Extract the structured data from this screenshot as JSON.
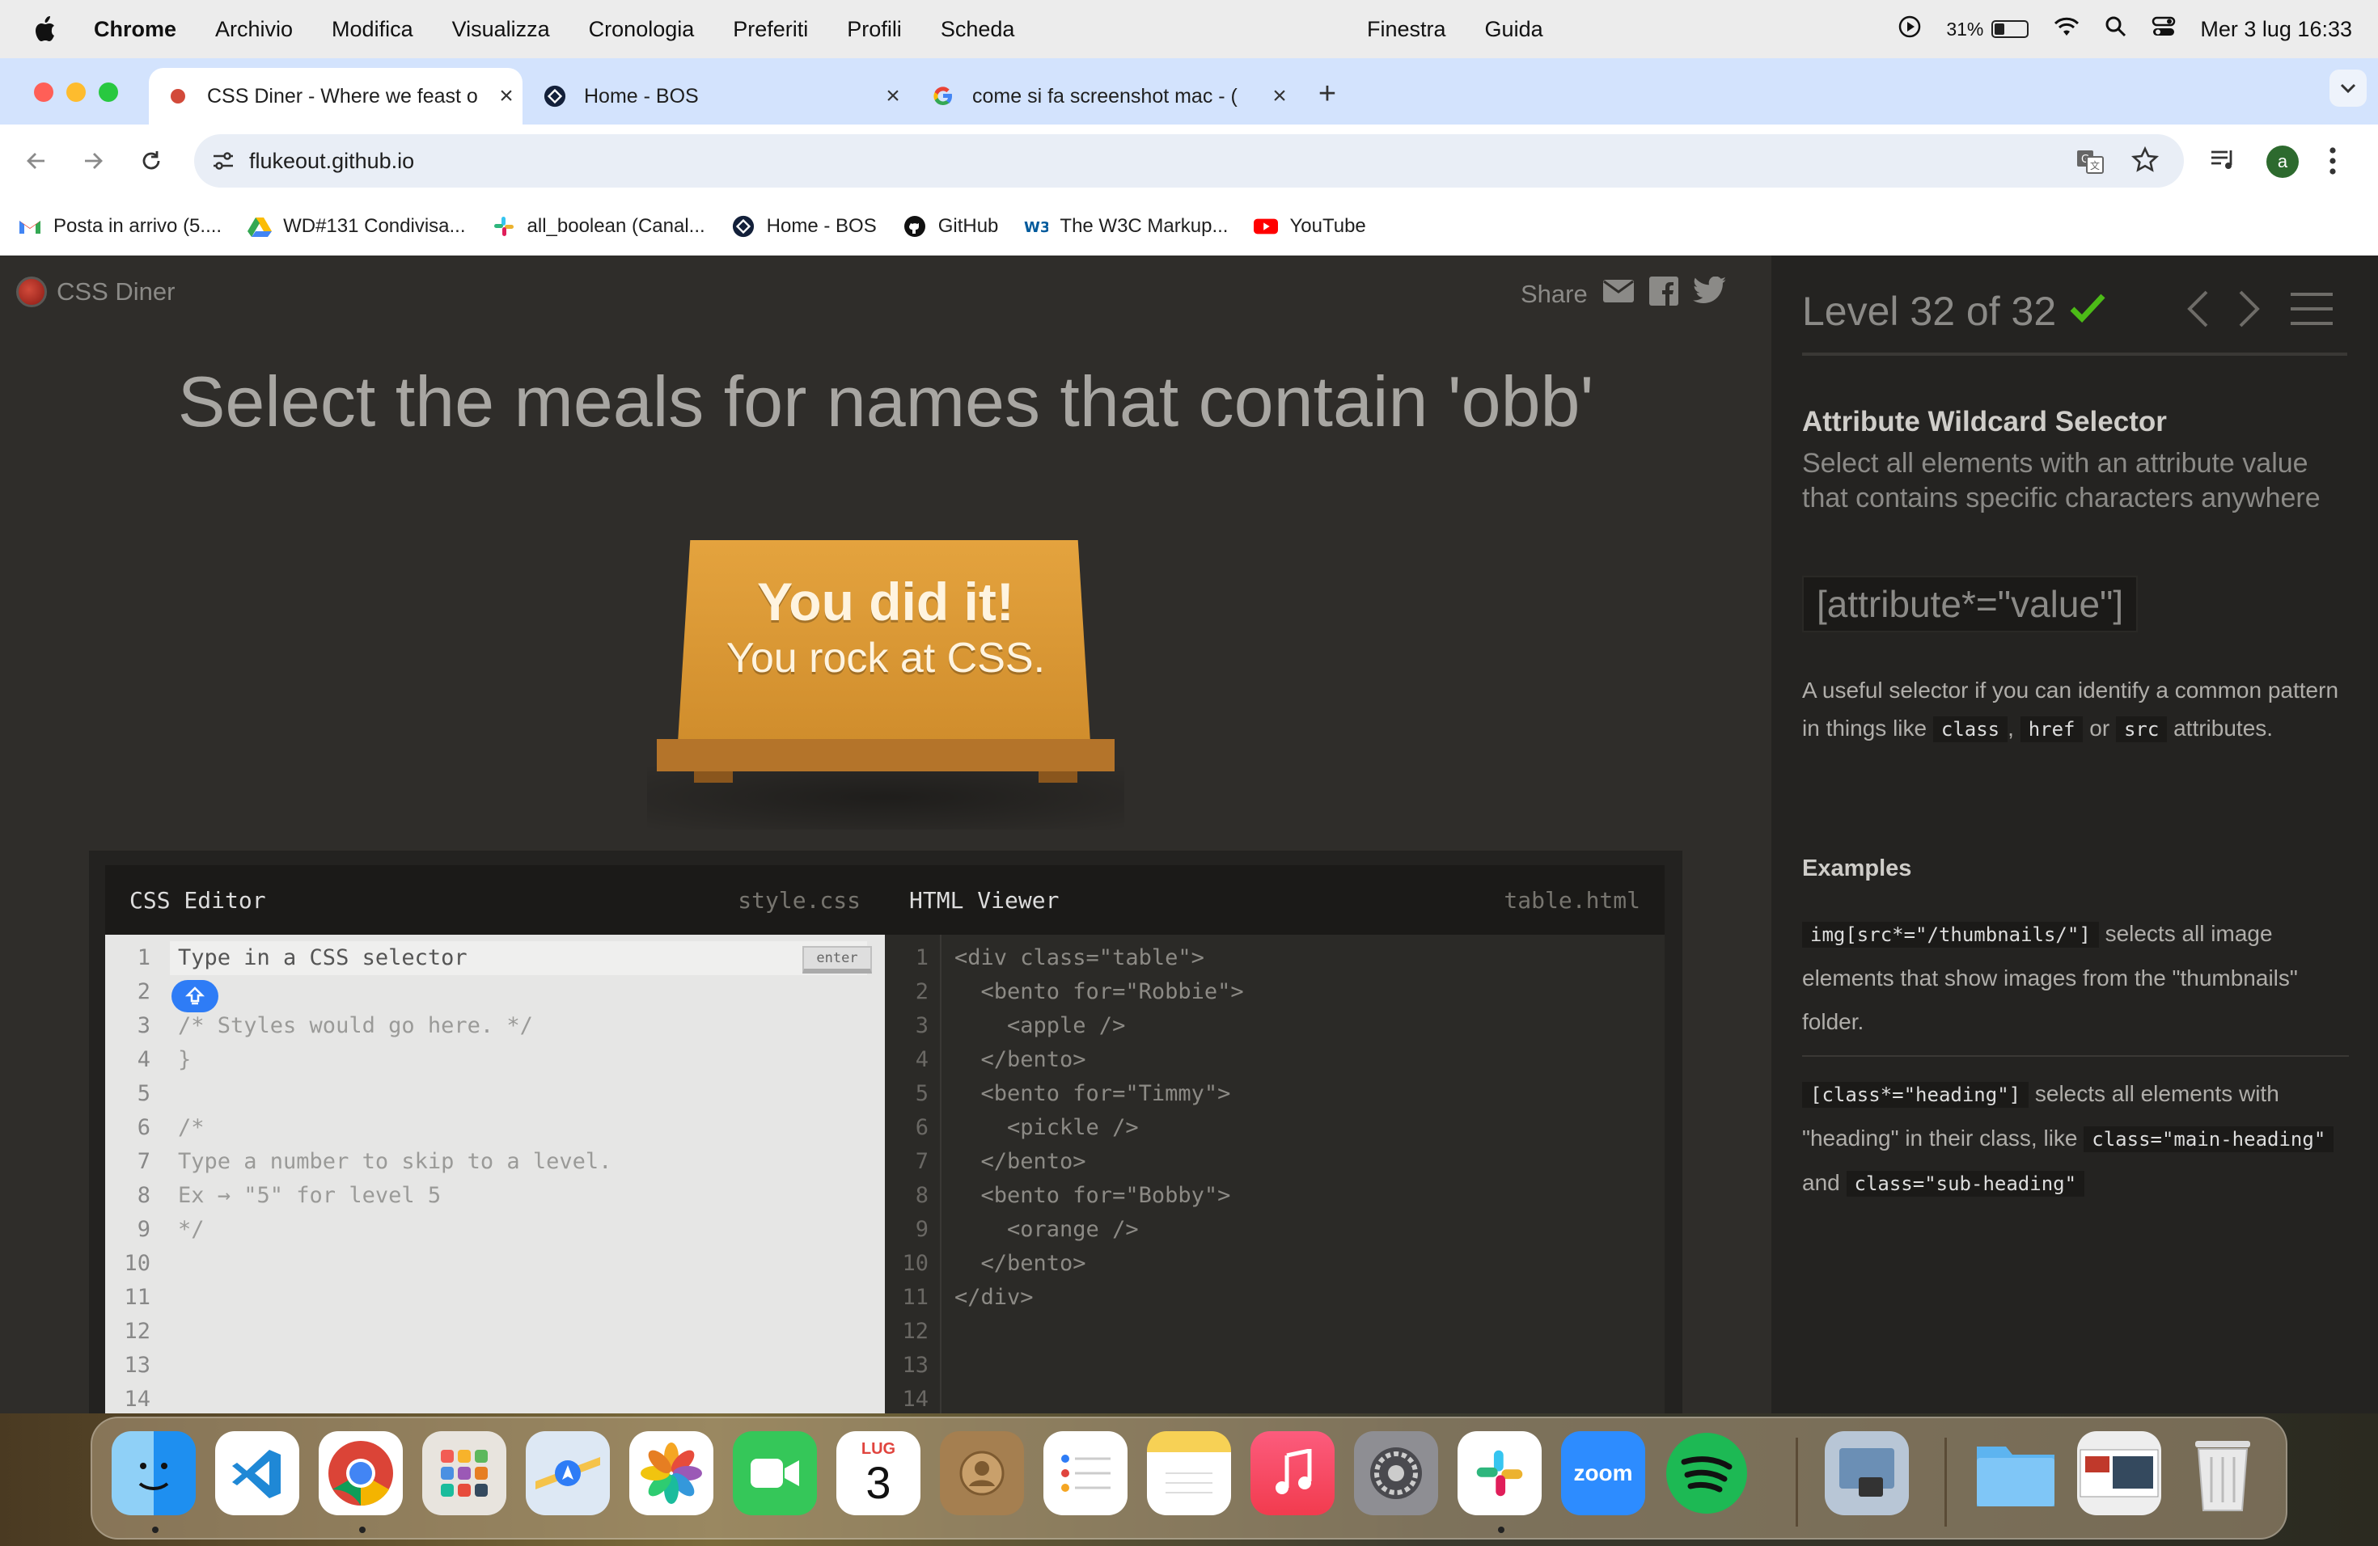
{
  "menubar": {
    "app_name": "Chrome",
    "items": [
      "Archivio",
      "Modifica",
      "Visualizza",
      "Cronologia",
      "Preferiti",
      "Profili",
      "Scheda"
    ],
    "center_items": [
      "Finestra",
      "Guida"
    ],
    "battery": "31%",
    "datetime": "Mer 3 lug  16:33"
  },
  "browser": {
    "tabs": [
      {
        "title": "CSS Diner - Where we feast o",
        "active": true
      },
      {
        "title": "Home - BOS",
        "active": false
      },
      {
        "title": "come si fa screenshot mac - (",
        "active": false
      }
    ],
    "url": "flukeout.github.io",
    "avatar_letter": "a",
    "bookmarks": [
      {
        "label": "Posta in arrivo (5....",
        "icon": "gmail-icon"
      },
      {
        "label": "WD#131 Condivisa...",
        "icon": "drive-icon"
      },
      {
        "label": "all_boolean (Canal...",
        "icon": "slack-icon"
      },
      {
        "label": "Home - BOS",
        "icon": "bos-icon"
      },
      {
        "label": "GitHub",
        "icon": "github-icon"
      },
      {
        "label": "The W3C Markup...",
        "icon": "w3c-icon"
      },
      {
        "label": "YouTube",
        "icon": "youtube-icon"
      }
    ]
  },
  "game": {
    "logo": "CSS Diner",
    "share": "Share",
    "order": "Select the meals for names that contain 'obb'",
    "win_title": "You did it!",
    "win_subtitle": "You rock at CSS.",
    "css_editor": {
      "title": "CSS Editor",
      "file": "style.css",
      "enter": "enter",
      "lines": [
        "Type in a CSS selector",
        "{",
        "/* Styles would go here. */",
        "}",
        "",
        "/*",
        "Type a number to skip to a level.",
        "Ex → \"5\" for level 5",
        "*/",
        "",
        "",
        "",
        "",
        ""
      ]
    },
    "html_viewer": {
      "title": "HTML Viewer",
      "file": "table.html",
      "lines": [
        "<div class=\"table\">",
        "  <bento for=\"Robbie\">",
        "    <apple />",
        "  </bento>",
        "  <bento for=\"Timmy\">",
        "    <pickle />",
        "  </bento>",
        "  <bento for=\"Bobby\">",
        "    <orange />",
        "  </bento>",
        "</div>",
        "",
        "",
        ""
      ]
    }
  },
  "panel": {
    "level": "Level 32 of 32",
    "title": "Attribute Wildcard Selector",
    "description": "Select all elements with an attribute value that contains specific characters anywhere",
    "syntax": "[attribute*=\"value\"]",
    "hint_pre": "A useful selector if you can identify a common pattern in things like",
    "hint_code1": "class",
    "hint_sep": ",",
    "hint_code2": "href",
    "hint_or": "or",
    "hint_code3": "src",
    "hint_post": "attributes.",
    "examples_title": "Examples",
    "ex1_code": "img[src*=\"/thumbnails/\"]",
    "ex1_text": "selects all image elements that show images from the \"thumbnails\" folder.",
    "ex2_code": "[class*=\"heading\"]",
    "ex2_text": "selects all elements with \"heading\" in their class, like",
    "ex2_code2": "class=\"main-heading\"",
    "ex2_and": "and",
    "ex2_code3": "class=\"sub-heading\"",
    "accent": "#4cbb17"
  },
  "dock": {
    "calendar_month": "LUG",
    "calendar_day": "3",
    "zoom": "zoom"
  }
}
